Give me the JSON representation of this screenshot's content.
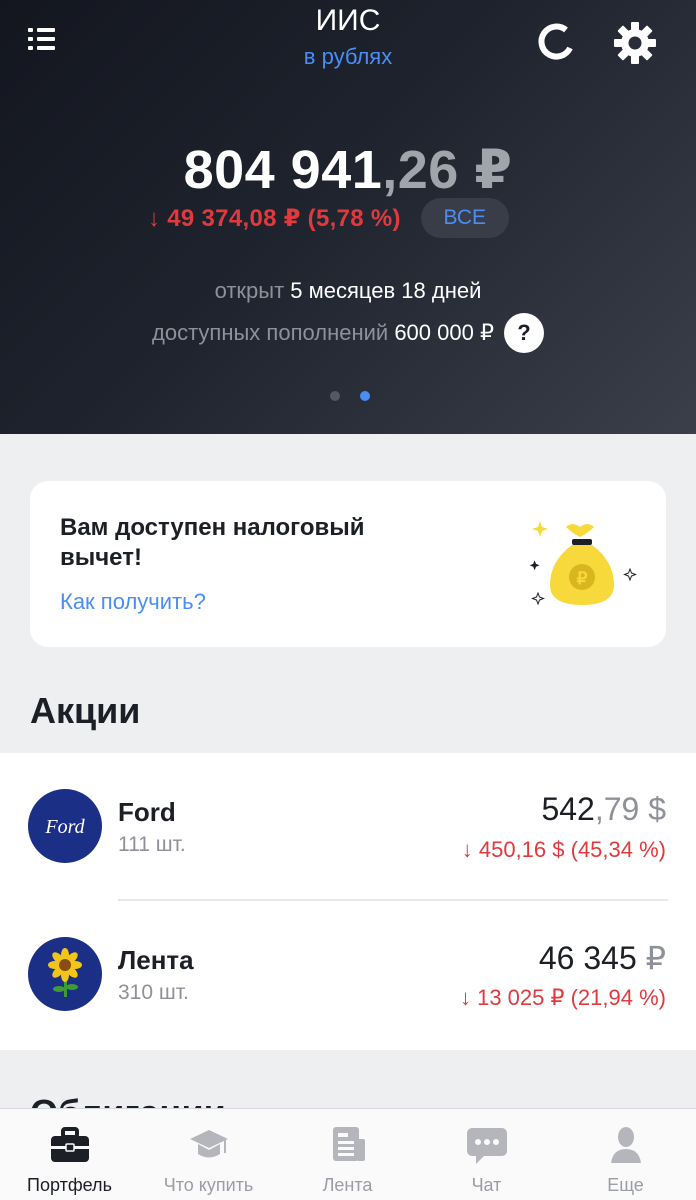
{
  "header": {
    "title": "ИИС",
    "subtitle": "в рублях",
    "total_int": "804 941",
    "total_frac": ",26",
    "total_cur": " ₽",
    "change": "↓ 49 374,08 ₽ (5,78 %)",
    "all_label": "ВСЕ",
    "opened_label": "открыт",
    "opened_value": "5 месяцев 18 дней",
    "deposits_label": "доступных пополнений",
    "deposits_value": "600 000 ₽",
    "help_label": "?",
    "page_dots": 2,
    "active_dot": 1
  },
  "tax_card": {
    "title": "Вам доступен налоговый вычет!",
    "link": "Как получить?"
  },
  "section": {
    "stocks_title": "Акции",
    "bonds_title": "Облигации"
  },
  "stocks": [
    {
      "name": "Ford",
      "qty": "111 шт.",
      "value_int": "542",
      "value_frac": ",79 $",
      "change": "↓ 450,16 $ (45,34 %)",
      "logo": "ford-logo"
    },
    {
      "name": "Лента",
      "qty": "310 шт.",
      "value_int": "46 345",
      "value_frac": " ₽",
      "change": "↓ 13 025 ₽ (21,94 %)",
      "logo": "sunflower-logo"
    }
  ],
  "tabs": [
    {
      "label": "Портфель",
      "icon": "briefcase-icon",
      "active": true
    },
    {
      "label": "Что купить",
      "icon": "graduation-cap-icon",
      "active": false
    },
    {
      "label": "Лента",
      "icon": "news-icon",
      "active": false
    },
    {
      "label": "Чат",
      "icon": "chat-icon",
      "active": false
    },
    {
      "label": "Еще",
      "icon": "person-icon",
      "active": false
    }
  ],
  "colors": {
    "accent": "#4a8df6",
    "negative": "#e0393e",
    "header_bg": "#1a1e27"
  }
}
